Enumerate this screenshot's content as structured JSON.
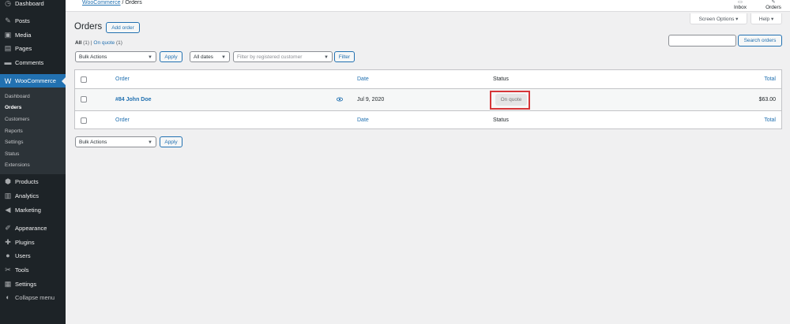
{
  "sidebar": {
    "items": [
      {
        "label": "Dashboard",
        "icon": "dashboard-icon",
        "glyph": "◷"
      },
      {
        "label": "Posts",
        "icon": "pin-icon",
        "glyph": "✎"
      },
      {
        "label": "Media",
        "icon": "media-icon",
        "glyph": "▣"
      },
      {
        "label": "Pages",
        "icon": "pages-icon",
        "glyph": "▤"
      },
      {
        "label": "Comments",
        "icon": "comments-icon",
        "glyph": "▬"
      },
      {
        "label": "WooCommerce",
        "icon": "woo-icon",
        "glyph": "W"
      },
      {
        "label": "Products",
        "icon": "products-icon",
        "glyph": "⬢"
      },
      {
        "label": "Analytics",
        "icon": "analytics-icon",
        "glyph": "▥"
      },
      {
        "label": "Marketing",
        "icon": "megaphone-icon",
        "glyph": "◀"
      },
      {
        "label": "Appearance",
        "icon": "brush-icon",
        "glyph": "✐"
      },
      {
        "label": "Plugins",
        "icon": "plug-icon",
        "glyph": "✚"
      },
      {
        "label": "Users",
        "icon": "user-icon",
        "glyph": "●"
      },
      {
        "label": "Tools",
        "icon": "wrench-icon",
        "glyph": "✂"
      },
      {
        "label": "Settings",
        "icon": "settings-icon",
        "glyph": "▦"
      },
      {
        "label": "Collapse menu",
        "icon": "collapse-icon",
        "glyph": "◐"
      }
    ],
    "submenu": [
      "Dashboard",
      "Orders",
      "Customers",
      "Reports",
      "Settings",
      "Status",
      "Extensions"
    ],
    "active_submenu": "Orders"
  },
  "header": {
    "breadcrumb_link": "WooCommerce",
    "breadcrumb_sep": " / ",
    "breadcrumb_current": "Orders",
    "inbox_label": "Inbox",
    "orders_label": "Orders"
  },
  "screen_options": "Screen Options ▾",
  "help": "Help ▾",
  "page": {
    "title": "Orders",
    "add_order": "Add order",
    "filter_all": "All",
    "filter_all_count": "(1)",
    "filter_sep": "|",
    "filter_quote": "On quote",
    "filter_quote_count": "(1)",
    "bulk_actions": "Bulk Actions",
    "apply": "Apply",
    "all_dates": "All dates",
    "customer_placeholder": "Filter by registered customer",
    "filter_btn": "Filter",
    "search_btn": "Search orders"
  },
  "table": {
    "headers": {
      "order": "Order",
      "date": "Date",
      "status": "Status",
      "total": "Total"
    },
    "rows": [
      {
        "order": "#84 John Doe",
        "date": "Jul 9, 2020",
        "status": "On quote",
        "total": "$63.00"
      }
    ]
  },
  "colors": {
    "accent": "#2271b1",
    "sidebar": "#1d2327",
    "highlight": "#d63638"
  }
}
